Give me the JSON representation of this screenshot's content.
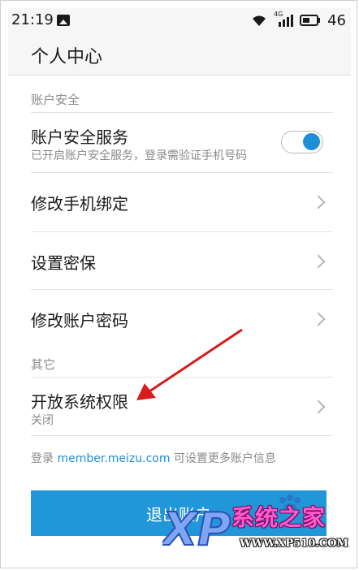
{
  "status_bar": {
    "time": "21:19",
    "network": "4G",
    "battery": "46",
    "icons": [
      "image-icon",
      "wifi-icon",
      "signal-icon",
      "battery-icon"
    ]
  },
  "header": {
    "title": "个人中心"
  },
  "sections": {
    "security": {
      "label": "账户安全",
      "items": [
        {
          "title": "账户安全服务",
          "subtitle": "已开启账户安全服务，登录需验证手机号码",
          "toggle_on": true
        },
        {
          "title": "修改手机绑定"
        },
        {
          "title": "设置密保"
        },
        {
          "title": "修改账户密码"
        }
      ]
    },
    "other": {
      "label": "其它",
      "items": [
        {
          "title": "开放系统权限",
          "subtitle": "关闭"
        }
      ]
    }
  },
  "footer": {
    "prefix": "登录 ",
    "link": "member.meizu.com",
    "suffix": " 可设置更多账户信息"
  },
  "logout_label": "退出账户",
  "watermark": {
    "brand_logo": "XP",
    "cn_text": "系统之家",
    "url": "WWW.XP510.COM"
  },
  "colors": {
    "accent": "#1e8fd6",
    "button": "#2196d8",
    "annotation_arrow": "#d81b1b"
  }
}
